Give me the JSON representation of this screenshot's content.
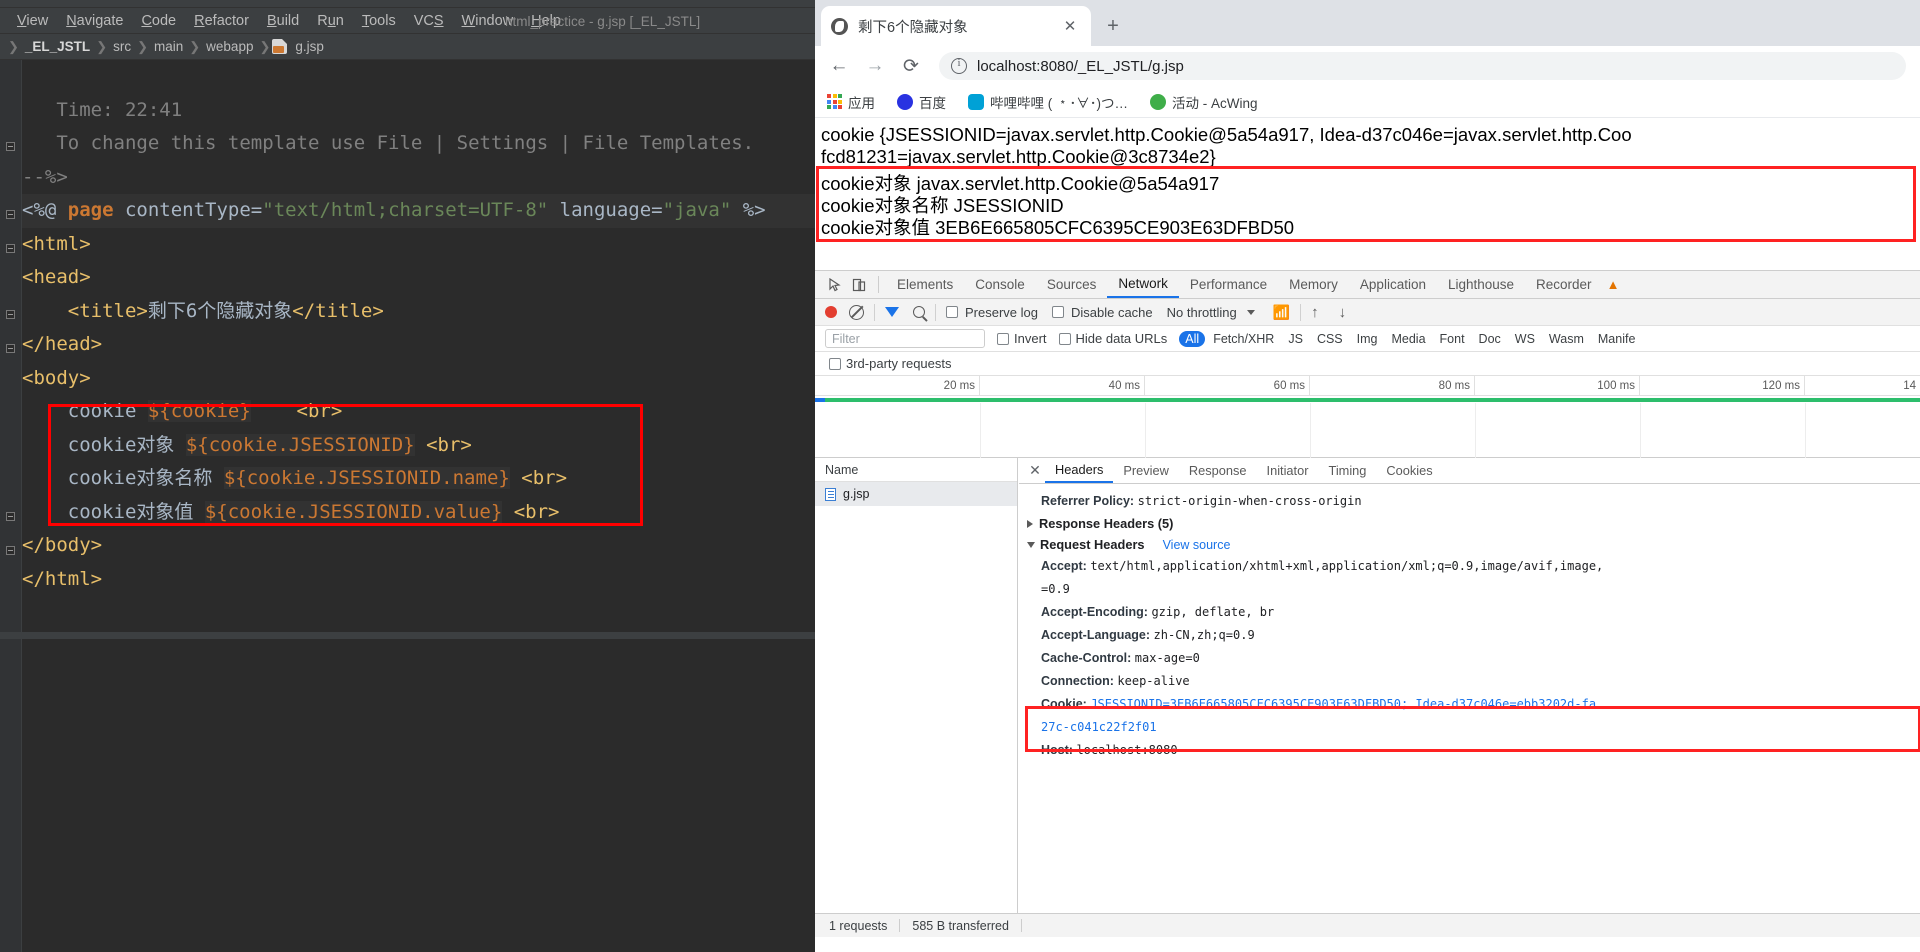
{
  "ide": {
    "menu": [
      "View",
      "Navigate",
      "Code",
      "Refactor",
      "Build",
      "Run",
      "Tools",
      "VCS",
      "Window",
      "Help"
    ],
    "window_title": "html_practice - g.jsp [_EL_JSTL]",
    "breadcrumb": [
      "_EL_JSTL",
      "src",
      "main",
      "webapp",
      "g.jsp"
    ],
    "code_lines": [
      {
        "text": "   Time: 22:41",
        "kind": "comment"
      },
      {
        "text": "   To change this template use File | Settings | File Templates.",
        "kind": "comment"
      },
      {
        "text": "--%>",
        "kind": "comment"
      },
      {
        "text": "<%@ page contentType=\"text/html;charset=UTF-8\" language=\"java\" %>",
        "kind": "directive"
      },
      {
        "text": "<html>",
        "kind": "tag"
      },
      {
        "text": "<head>",
        "kind": "tag"
      },
      {
        "text": "    <title>剩下6个隐藏对象</title>",
        "kind": "tag"
      },
      {
        "text": "</head>",
        "kind": "tag"
      },
      {
        "text": "<body>",
        "kind": "tag"
      },
      {
        "text": "    cookie ${cookie}    <br>",
        "kind": "el"
      },
      {
        "text": "    cookie对象 ${cookie.JSESSIONID} <br>",
        "kind": "el"
      },
      {
        "text": "    cookie对象名称 ${cookie.JSESSIONID.name} <br>",
        "kind": "el"
      },
      {
        "text": "    cookie对象值 ${cookie.JSESSIONID.value} <br>",
        "kind": "el"
      },
      {
        "text": "</body>",
        "kind": "tag"
      },
      {
        "text": "</html>",
        "kind": "tag"
      }
    ]
  },
  "browser": {
    "tab_title": "剩下6个隐藏对象",
    "new_tab_label": "+",
    "close_label": "✕",
    "back_label": "←",
    "forward_label": "→",
    "reload_label": "⟳",
    "url": "localhost:8080/_EL_JSTL/g.jsp",
    "bookmarks": [
      {
        "label": "应用",
        "icon": "apps-grid-icon"
      },
      {
        "label": "百度",
        "icon": "baidu-icon"
      },
      {
        "label": "哔哩哔哩 ( ﹡･∀･)つ…",
        "icon": "bilibili-icon"
      },
      {
        "label": "活动 - AcWing",
        "icon": "acwing-icon"
      }
    ],
    "page_lines": [
      "cookie {JSESSIONID=javax.servlet.http.Cookie@5a54a917, Idea-d37c046e=javax.servlet.http.Coo",
      "fcd81231=javax.servlet.http.Cookie@3c8734e2}",
      "cookie对象 javax.servlet.http.Cookie@5a54a917",
      "cookie对象名称 JSESSIONID",
      "cookie对象值 3EB6E665805CFC6395CE903E63DFBD50"
    ]
  },
  "devtools": {
    "panels": [
      "Elements",
      "Console",
      "Sources",
      "Network",
      "Performance",
      "Memory",
      "Application",
      "Lighthouse",
      "Recorder"
    ],
    "selected_panel": "Network",
    "toolbar": {
      "preserve_log": "Preserve log",
      "disable_cache": "Disable cache",
      "throttling": "No throttling"
    },
    "filter": {
      "placeholder": "Filter",
      "invert": "Invert",
      "hide_data_urls": "Hide data URLs",
      "types": [
        "All",
        "Fetch/XHR",
        "JS",
        "CSS",
        "Img",
        "Media",
        "Font",
        "Doc",
        "WS",
        "Wasm",
        "Manife"
      ],
      "selected_type": "All",
      "third_party": "3rd-party requests"
    },
    "timeline_ticks": [
      "20 ms",
      "40 ms",
      "60 ms",
      "80 ms",
      "100 ms",
      "120 ms",
      "14"
    ],
    "names_header": "Name",
    "requests": [
      "g.jsp"
    ],
    "detail_tabs": [
      "Headers",
      "Preview",
      "Response",
      "Initiator",
      "Timing",
      "Cookies"
    ],
    "selected_detail_tab": "Headers",
    "headers": {
      "referrer_policy_key": "Referrer Policy:",
      "referrer_policy_val": "strict-origin-when-cross-origin",
      "response_section": "Response Headers (5)",
      "request_section": "Request Headers",
      "view_source": "View source",
      "rows": [
        {
          "key": "Accept:",
          "val": "text/html,application/xhtml+xml,application/xml;q=0.9,image/avif,image,"
        },
        {
          "key": "",
          "val": "=0.9"
        },
        {
          "key": "Accept-Encoding:",
          "val": "gzip, deflate, br"
        },
        {
          "key": "Accept-Language:",
          "val": "zh-CN,zh;q=0.9"
        },
        {
          "key": "Cache-Control:",
          "val": "max-age=0"
        },
        {
          "key": "Connection:",
          "val": "keep-alive"
        }
      ],
      "cookie_key": "Cookie:",
      "cookie_val_line1": "JSESSIONID=3EB6E665805CFC6395CE903E63DFBD50; Idea-d37c046e=ebb3202d-fa",
      "cookie_val_line2": "27c-c041c22f2f01",
      "host_key": "Host:",
      "host_val": "localhost:8080"
    },
    "status": {
      "requests": "1 requests",
      "transferred": "585 B transferred"
    }
  },
  "colors": {
    "accent": "#1a73e8",
    "highlight_box": "#ff2222",
    "record": "#e33e30",
    "ide_bg": "#2b2b2b"
  }
}
